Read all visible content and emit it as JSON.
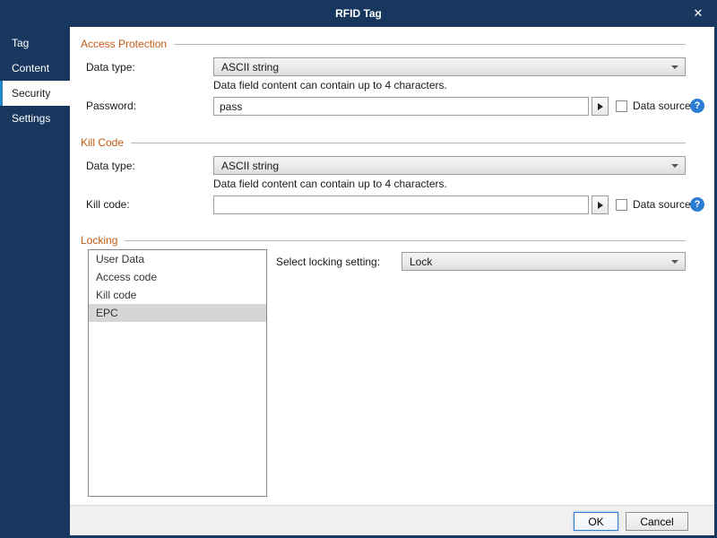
{
  "dialog": {
    "title": "RFID Tag",
    "close_icon": "✕"
  },
  "colors": {
    "titlebar_navy": "#17375e",
    "section_header_orange": "#c05a12",
    "help_icon_blue": "#2b7cd3",
    "list_selection_gray": "#d6d6d6",
    "sidebar_selected_accent": "#1e88c7"
  },
  "sidebar": {
    "items": [
      {
        "label": "Tag",
        "selected": false
      },
      {
        "label": "Content",
        "selected": false
      },
      {
        "label": "Security",
        "selected": true
      },
      {
        "label": "Settings",
        "selected": false
      }
    ]
  },
  "sections": {
    "access_protection": {
      "title": "Access Protection",
      "data_type_label": "Data type:",
      "data_type_value": "ASCII string",
      "helper_text": "Data field content can contain up to 4 characters.",
      "password_label": "Password:",
      "password_value": "pass",
      "data_source_label": "Data source",
      "help_icon": "?"
    },
    "kill_code": {
      "title": "Kill Code",
      "data_type_label": "Data type:",
      "data_type_value": "ASCII string",
      "helper_text": "Data field content can contain up to 4 characters.",
      "kill_code_label": "Kill code:",
      "kill_code_value": "",
      "data_source_label": "Data source",
      "help_icon": "?"
    },
    "locking": {
      "title": "Locking",
      "list_items": [
        {
          "label": "User Data",
          "selected": false
        },
        {
          "label": "Access code",
          "selected": false
        },
        {
          "label": "Kill code",
          "selected": false
        },
        {
          "label": "EPC",
          "selected": true
        }
      ],
      "select_label": "Select locking setting:",
      "select_value": "Lock"
    }
  },
  "footer": {
    "ok_label": "OK",
    "cancel_label": "Cancel"
  }
}
